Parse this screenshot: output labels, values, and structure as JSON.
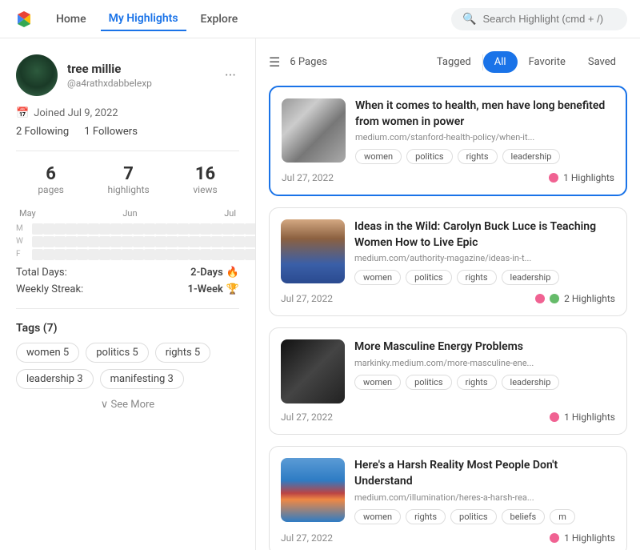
{
  "nav": {
    "home_label": "Home",
    "my_highlights_label": "My Highlights",
    "explore_label": "Explore",
    "search_placeholder": "Search Highlight (cmd + /)"
  },
  "sidebar": {
    "username": "tree millie",
    "handle": "@a4rathxdabbelexp",
    "joined": "Joined Jul 9, 2022",
    "following": "2 Following",
    "followers": "1 Followers",
    "stats": {
      "pages": "6",
      "pages_label": "pages",
      "highlights": "7",
      "highlights_label": "highlights",
      "views": "16",
      "views_label": "views"
    },
    "months": [
      "May",
      "Jun",
      "Jul"
    ],
    "total_days_label": "Total Days:",
    "total_days_val": "2-Days",
    "weekly_streak_label": "Weekly Streak:",
    "weekly_streak_val": "1-Week",
    "tags_title": "Tags (7)",
    "tags": [
      "women 5",
      "politics 5",
      "rights 5",
      "leadership 3",
      "manifesting 3"
    ],
    "see_more": "∨ See More"
  },
  "filter": {
    "pages_label": "6 Pages",
    "tabs": [
      "Tagged",
      "All",
      "Favorite",
      "Saved"
    ]
  },
  "highlights": [
    {
      "id": 1,
      "title": "When it comes to health, men have long benefited from women in power",
      "url": "medium.com/stanford-health-policy/when-it...",
      "tags": [
        "women",
        "politics",
        "rights",
        "leadership"
      ],
      "date": "Jul 27, 2022",
      "highlight_count": "1 Highlights",
      "dots": [
        "pink"
      ],
      "selected": true,
      "thumb_type": "bw"
    },
    {
      "id": 2,
      "title": "Ideas in the Wild: Carolyn Buck Luce is Teaching Women How to Live Epic",
      "url": "medium.com/authority-magazine/ideas-in-t...",
      "tags": [
        "women",
        "politics",
        "rights",
        "leadership"
      ],
      "date": "Jul 27, 2022",
      "highlight_count": "2 Highlights",
      "dots": [
        "pink",
        "green"
      ],
      "selected": false,
      "thumb_type": "woman"
    },
    {
      "id": 3,
      "title": "More Masculine Energy Problems",
      "url": "markinky.medium.com/more-masculine-ene...",
      "tags": [
        "women",
        "politics",
        "rights",
        "leadership"
      ],
      "date": "Jul 27, 2022",
      "highlight_count": "1 Highlights",
      "dots": [
        "pink"
      ],
      "selected": false,
      "thumb_type": "dark"
    },
    {
      "id": 4,
      "title": "Here's a Harsh Reality Most People Don't Understand",
      "url": "medium.com/illumination/heres-a-harsh-rea...",
      "tags": [
        "women",
        "rights",
        "politics",
        "beliefs",
        "m"
      ],
      "date": "Jul 27, 2022",
      "highlight_count": "1 Highlights",
      "dots": [
        "pink"
      ],
      "selected": false,
      "thumb_type": "water"
    }
  ]
}
